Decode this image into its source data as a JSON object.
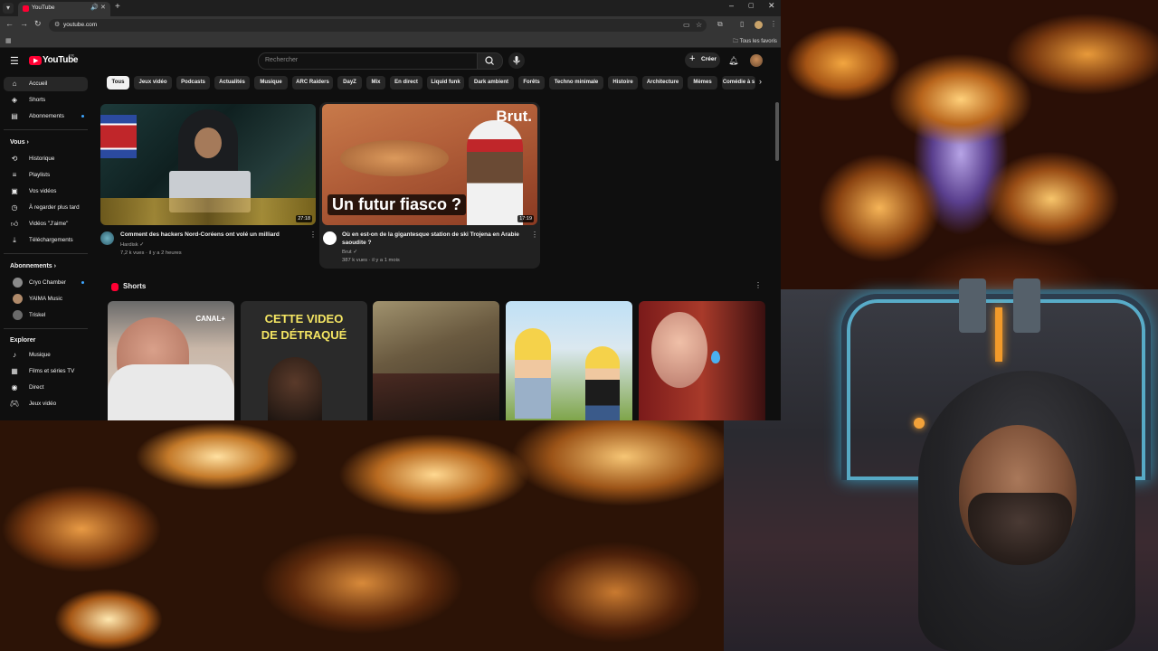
{
  "browser": {
    "tab_title": "YouTube",
    "url": "youtube.com",
    "bookmarks_all": "Tous les favoris"
  },
  "youtube": {
    "logo": "YouTube",
    "logo_country": "FR",
    "search_placeholder": "Rechercher",
    "create_label": "Créer",
    "sidebar": {
      "main": [
        {
          "label": "Accueil",
          "icon": "home-icon"
        },
        {
          "label": "Shorts",
          "icon": "shorts-icon"
        },
        {
          "label": "Abonnements",
          "icon": "subscriptions-icon"
        }
      ],
      "you_heading": "Vous",
      "you": [
        {
          "label": "Historique",
          "icon": "history-icon"
        },
        {
          "label": "Playlists",
          "icon": "playlists-icon"
        },
        {
          "label": "Vos vidéos",
          "icon": "your-videos-icon"
        },
        {
          "label": "À regarder plus tard",
          "icon": "watch-later-icon"
        },
        {
          "label": "Vidéos \"J'aime\"",
          "icon": "liked-icon"
        },
        {
          "label": "Téléchargements",
          "icon": "downloads-icon"
        }
      ],
      "subs_heading": "Abonnements",
      "subs": [
        {
          "label": "Cryo Chamber",
          "color": "#8a8a8a"
        },
        {
          "label": "YAIMA Music",
          "color": "#b08a6a"
        },
        {
          "label": "Triskel",
          "color": "#6a6a6a"
        }
      ],
      "explore_heading": "Explorer",
      "explore": [
        {
          "label": "Musique",
          "icon": "music-icon"
        },
        {
          "label": "Films et séries TV",
          "icon": "movies-icon"
        },
        {
          "label": "Direct",
          "icon": "live-icon"
        },
        {
          "label": "Jeux vidéo",
          "icon": "gaming-icon"
        }
      ]
    },
    "chips": [
      "Tous",
      "Jeux vidéo",
      "Podcasts",
      "Actualités",
      "Musique",
      "ARC Raiders",
      "DayZ",
      "Mix",
      "En direct",
      "Liquid funk",
      "Dark ambient",
      "Forêts",
      "Techno minimale",
      "Histoire",
      "Architecture",
      "Mèmes",
      "Comédie à s"
    ],
    "videos": [
      {
        "title": "Comment des hackers Nord-Coréens ont volé un milliard",
        "channel": "Hardisk",
        "meta": "7,2 k vues · il y a 2 heures",
        "duration": "27:18"
      },
      {
        "title_line1": "Où en est-on de la gigantesque station de ski Trojena en Arabie",
        "title_line2": "saoudite ?",
        "channel": "Brut",
        "meta": "387 k vues · il y a 1 mois",
        "duration": "17:19",
        "overlay_text": "Un futur fiasco ?",
        "brand": "Brut."
      }
    ],
    "shorts_heading": "Shorts",
    "shorts": [
      {
        "overlay": "CANAL+"
      },
      {
        "overlay_line1": "CETTE VIDEO",
        "overlay_line2": "DE DÉTRAQUÉ"
      },
      {
        "overlay": ""
      },
      {
        "overlay": ""
      },
      {
        "overlay": ""
      }
    ]
  }
}
